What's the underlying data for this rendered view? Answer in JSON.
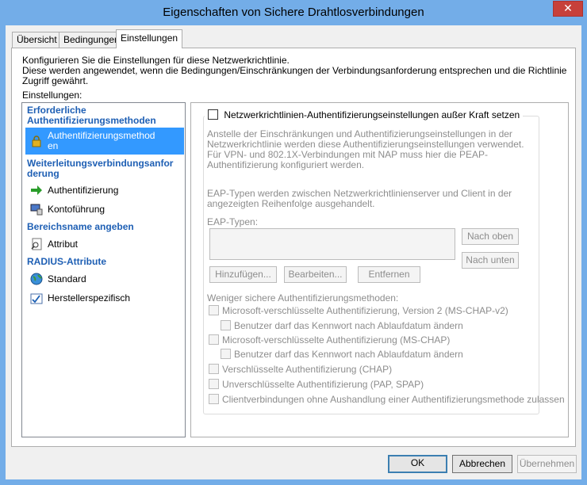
{
  "window": {
    "title": "Eigenschaften von Sichere Drahtlosverbindungen",
    "close": "✕"
  },
  "tabs": [
    "Übersicht",
    "Bedingungen",
    "Einstellungen"
  ],
  "description": {
    "line1": "Konfigurieren Sie die Einstellungen für diese Netzwerkrichtlinie.",
    "line2": "Diese werden angewendet, wenn die Bedingungen/Einschränkungen der Verbindungsanforderung entsprechen und die Richtlinie Zugriff gewährt."
  },
  "settings_label": "Einstellungen:",
  "nav": {
    "header1": "Erforderliche Authentifizierungsmethoden",
    "item_auth_methods": "Authentifizierungsmethoden",
    "header2": "Weiterleitungsverbindungsanforderung",
    "item_authentifizierung": "Authentifizierung",
    "item_kontofuehrung": "Kontoführung",
    "header3": "Bereichsname angeben",
    "item_attribut": "Attribut",
    "header4": "RADIUS-Attribute",
    "item_standard": "Standard",
    "item_hersteller": "Herstellerspezifisch"
  },
  "content": {
    "override_label": "Netzwerkrichtlinien-Authentifizierungseinstellungen außer Kraft setzen",
    "p1": "Anstelle der Einschränkungen und Authentifizierungseinstellungen in der Netzwerkrichtlinie werden diese Authentifizierungseinstellungen verwendet. Für VPN- und 802.1X-Verbindungen mit NAP muss hier die PEAP-Authentifizierung konfiguriert werden.",
    "p2": "EAP-Typen werden zwischen Netzwerkrichtlinienserver und Client in der angezeigten Reihenfolge ausgehandelt.",
    "eap_label": "EAP-Typen:",
    "btn_up": "Nach oben",
    "btn_down": "Nach unten",
    "btn_add": "Hinzufügen...",
    "btn_edit": "Bearbeiten...",
    "btn_remove": "Entfernen",
    "weniger": "Weniger sichere Authentifizierungsmethoden:",
    "cb1": "Microsoft-verschlüsselte Authentifizierung, Version 2 (MS-CHAP-v2)",
    "cb2": "Benutzer darf das Kennwort nach Ablaufdatum ändern",
    "cb3": "Microsoft-verschlüsselte Authentifizierung (MS-CHAP)",
    "cb4": "Benutzer darf das Kennwort nach Ablaufdatum ändern",
    "cb5": "Verschlüsselte Authentifizierung (CHAP)",
    "cb6": "Unverschlüsselte Authentifizierung (PAP, SPAP)",
    "cb7": "Clientverbindungen ohne Aushandlung einer Authentifizierungsmethode zulassen"
  },
  "footer": {
    "ok": "OK",
    "cancel": "Abbrechen",
    "apply": "Übernehmen"
  }
}
